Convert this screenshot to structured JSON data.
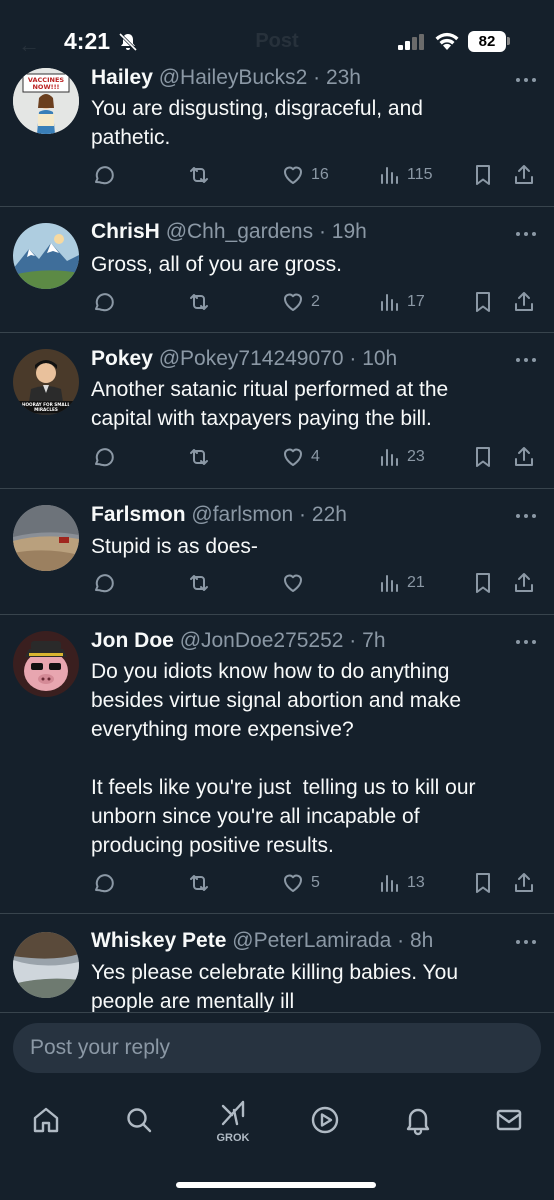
{
  "status_bar": {
    "time": "4:21",
    "battery": "82"
  },
  "header": {
    "title": "Post"
  },
  "replies": [
    {
      "name": "Hailey",
      "handle": "@HaileyBucks2",
      "time": "23h",
      "text": "You are disgusting, disgraceful, and\npathetic.",
      "reply_count": "",
      "repost_count": "",
      "like_count": "16",
      "view_count": "115",
      "avatar_text": [
        "VACCINES",
        "NOW!!!"
      ]
    },
    {
      "name": "ChrisH",
      "handle": "@Chh_gardens",
      "time": "19h",
      "text": "Gross, all of you are gross.",
      "reply_count": "",
      "repost_count": "",
      "like_count": "2",
      "view_count": "17"
    },
    {
      "name": "Pokey",
      "handle": "@Pokey714249070",
      "time": "10h",
      "text": "Another satanic ritual performed at the\ncapital with taxpayers paying the bill.",
      "reply_count": "",
      "repost_count": "",
      "like_count": "4",
      "view_count": "23",
      "avatar_text": [
        "HOORAY FOR SMALL",
        "MIRACLES"
      ]
    },
    {
      "name": "Farlsmon",
      "handle": "@farlsmon",
      "time": "22h",
      "text": "Stupid is as does-",
      "reply_count": "",
      "repost_count": "",
      "like_count": "",
      "view_count": "21"
    },
    {
      "name": "Jon Doe",
      "handle": "@JonDoe275252",
      "time": "7h",
      "text": "Do you idiots know how to do anything\nbesides virtue signal abortion and make\neverything more expensive?\n\nIt feels like you're just  telling us to kill our\nunborn since you're all incapable of\nproducing positive results.",
      "reply_count": "",
      "repost_count": "",
      "like_count": "5",
      "view_count": "13"
    },
    {
      "name": "Whiskey Pete",
      "handle": "@PeterLamirada",
      "time": "8h",
      "text": "Yes please celebrate killing babies. You\npeople are mentally ill"
    }
  ],
  "reply_box": {
    "placeholder": "Post your reply"
  },
  "nav": {
    "items": [
      "home-icon",
      "search-icon",
      "grok-icon",
      "video-icon",
      "notifications-icon",
      "messages-icon"
    ],
    "grok_label": "GROK"
  },
  "colors": {
    "background": "#15202b",
    "muted": "#8b98a5",
    "divider": "#38444d"
  }
}
